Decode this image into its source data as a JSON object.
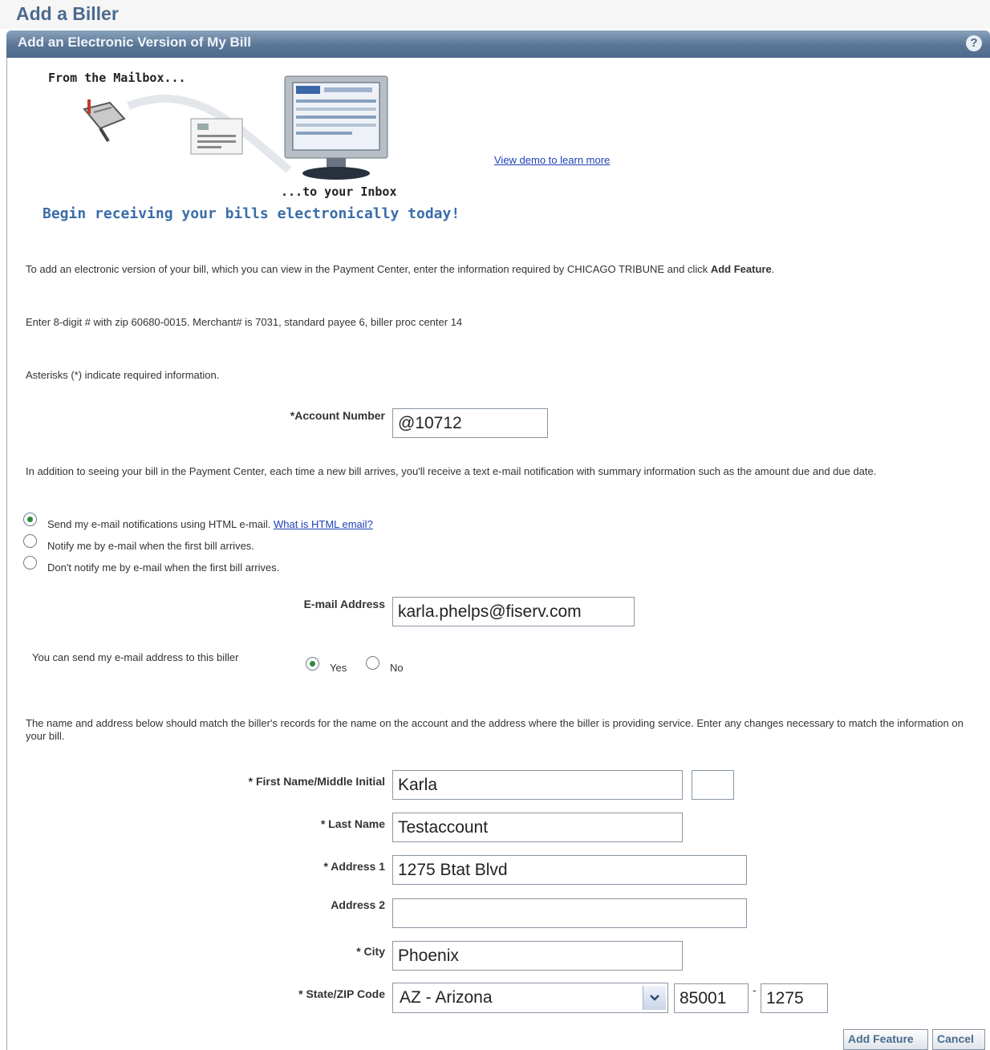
{
  "page": {
    "title": "Add a Biller"
  },
  "section": {
    "title": "Add an Electronic Version of My Bill",
    "help_icon": "?"
  },
  "banner": {
    "from_text": "From the Mailbox...",
    "to_text": "...to your Inbox",
    "tagline": "Begin receiving your bills electronically today!",
    "demo_link": "View demo to learn more"
  },
  "intro": {
    "text_before": "To add an electronic version of your bill, which you can view in the Payment Center, enter the information required by CHICAGO TRIBUNE and click ",
    "text_bold": "Add Feature",
    "text_after": ".",
    "biller_note": "Enter 8-digit # with zip 60680-0015. Merchant# is 7031, standard payee 6, biller proc center 14",
    "required_note": "Asterisks (*) indicate required information."
  },
  "account": {
    "label": "*Account Number",
    "value": "@10712"
  },
  "notification": {
    "text": "In addition to seeing your bill in the Payment Center, each time a new bill arrives, you'll receive a text e-mail notification with summary information such as the amount due and due date.",
    "options": [
      {
        "label": "Send my e-mail notifications using HTML e-mail.",
        "selected": true
      },
      {
        "label": "Notify me by e-mail when the first bill arrives.",
        "selected": false
      },
      {
        "label": "Don't notify me by e-mail when the first bill arrives.",
        "selected": false
      }
    ],
    "html_link": "What is HTML email?"
  },
  "email": {
    "label": "E-mail Address",
    "value": "karla.phelps@fiserv.com"
  },
  "share": {
    "label": "You can send my e-mail address to this biller",
    "yes": "Yes",
    "no": "No",
    "selected": "Yes"
  },
  "address_note": "The name and address below should match the biller's records for the name on the account and the address where the biller is providing service. Enter any changes necessary to match the information on your bill.",
  "form": {
    "first_name_label": "* First Name/Middle Initial",
    "first_name": "Karla",
    "middle_initial": "",
    "last_name_label": "* Last Name",
    "last_name": "Testaccount",
    "address1_label": "* Address 1",
    "address1": "1275 Btat Blvd",
    "address2_label": "Address 2",
    "address2": "",
    "city_label": "* City",
    "city": "Phoenix",
    "state_zip_label": "* State/ZIP Code",
    "state": "AZ - Arizona",
    "zip": "85001",
    "zip_separator": "-",
    "zip_ext": "1275"
  },
  "buttons": {
    "add": "Add Feature",
    "cancel": "Cancel"
  },
  "colors": {
    "header_bar": "#5a7595",
    "title": "#4b6b8f",
    "link": "#1f3fb6",
    "radio_selected": "#2e8b3d"
  }
}
